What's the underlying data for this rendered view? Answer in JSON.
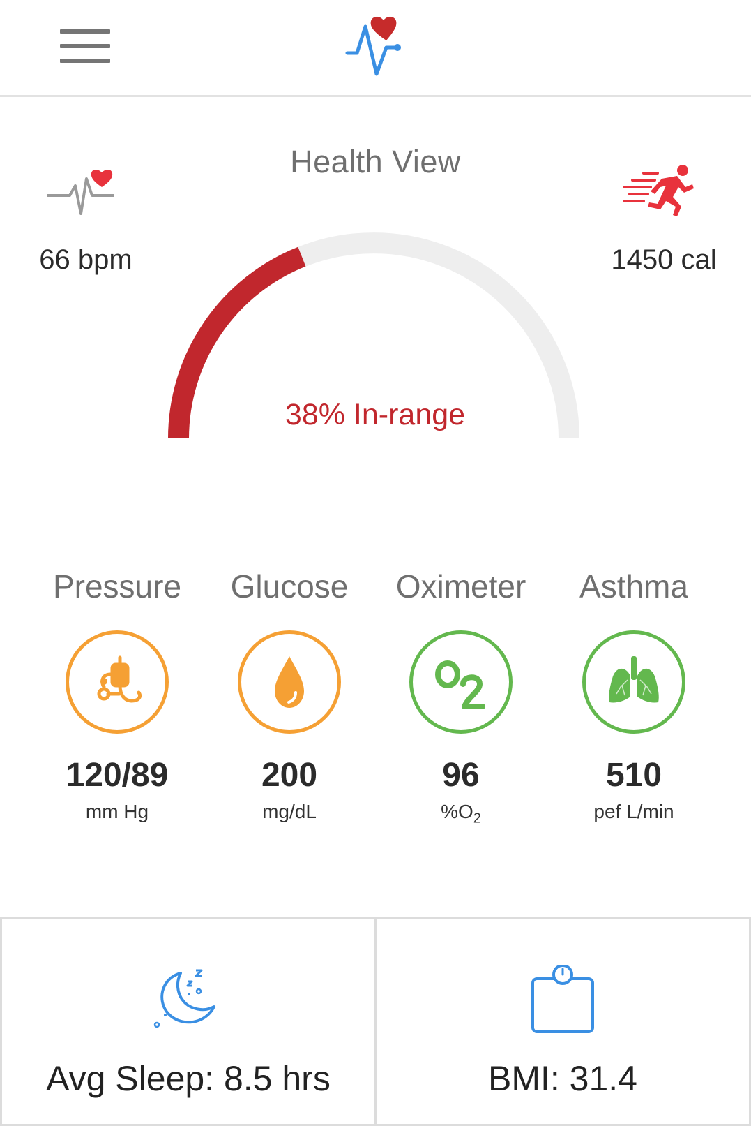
{
  "header": {
    "menu_icon": "hamburger-menu-icon",
    "logo_icon": "heartbeat-logo-icon"
  },
  "page": {
    "title": "Health View"
  },
  "heart_rate": {
    "icon": "heart-rate-icon",
    "value": "66 bpm"
  },
  "calories": {
    "icon": "running-man-icon",
    "value": "1450 cal"
  },
  "gauge": {
    "label": "38% In-range",
    "fraction": 0.38,
    "fill_color": "#c1272d",
    "track_color": "#eeeeee"
  },
  "metrics": [
    {
      "title": "Pressure",
      "icon": "blood-pressure-icon",
      "value": "120/89",
      "unit": "mm Hg",
      "status_color": "#f5a034"
    },
    {
      "title": "Glucose",
      "icon": "blood-drop-icon",
      "value": "200",
      "unit": "mg/dL",
      "status_color": "#f5a034"
    },
    {
      "title": "Oximeter",
      "icon": "oxygen-o2-icon",
      "value": "96",
      "unit": "%O",
      "unit_sub": "2",
      "status_color": "#63b84e"
    },
    {
      "title": "Asthma",
      "icon": "lungs-icon",
      "value": "510",
      "unit": "pef L/min",
      "status_color": "#63b84e"
    }
  ],
  "cards": {
    "sleep": {
      "icon": "moon-sleep-icon",
      "text": "Avg Sleep: 8.5 hrs"
    },
    "bmi": {
      "icon": "weight-scale-icon",
      "text": "BMI: 31.4"
    }
  },
  "colors": {
    "accent_blue": "#3a8fe3",
    "alert_red": "#c1272d",
    "warning_orange": "#f5a034",
    "ok_green": "#63b84e"
  }
}
